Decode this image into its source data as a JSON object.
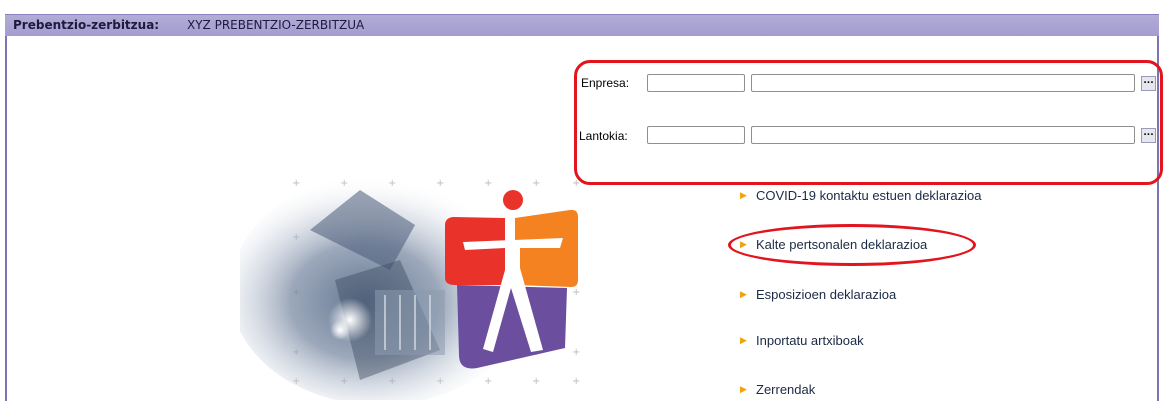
{
  "header": {
    "label": "Prebentzio-zerbitzua:",
    "value": "XYZ PREBENTZIO-ZERBITZUA"
  },
  "form": {
    "enpresa_label": "Enpresa:",
    "lantokia_label": "Lantokia:",
    "lookup_button": "..."
  },
  "menu": {
    "items": [
      {
        "label": "COVID-19 kontaktu estuen deklarazioa"
      },
      {
        "label": "Kalte pertsonalen deklarazioa"
      },
      {
        "label": "Esposizioen deklarazioa"
      },
      {
        "label": "Inportatu artxiboak"
      },
      {
        "label": "Zerrendak"
      }
    ]
  },
  "colors": {
    "header_bg": "#a39cd0",
    "annotation_red": "#e2141d",
    "bullet_orange": "#f2a20c",
    "logo_orange": "#f58220",
    "logo_red": "#e8322a",
    "logo_purple": "#6b4f9e"
  }
}
